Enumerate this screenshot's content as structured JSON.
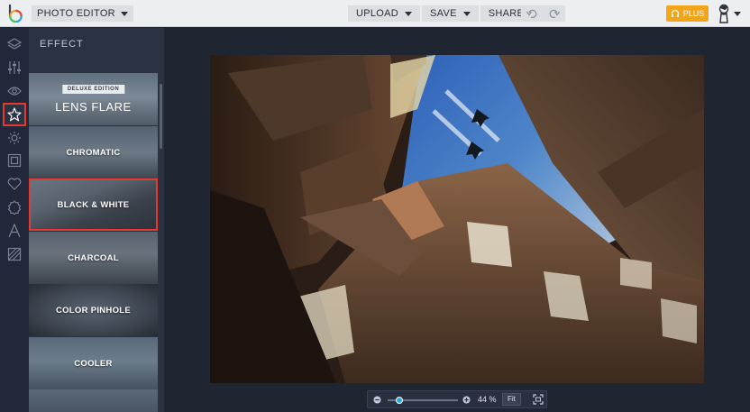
{
  "app": {
    "mode_label": "PHOTO EDITOR"
  },
  "toolbar": {
    "upload_label": "UPLOAD",
    "save_label": "SAVE",
    "share_label": "SHARE",
    "plus_label": "PLUS"
  },
  "rail": {
    "icons": [
      "layers-icon",
      "sliders-icon",
      "eye-icon",
      "star-icon",
      "gear-icon",
      "frame-icon",
      "heart-icon",
      "badge-icon",
      "text-icon",
      "texture-icon"
    ],
    "active": "star-icon"
  },
  "panel": {
    "title": "EFFECT",
    "effects": [
      {
        "badge": "DELUXE EDITION",
        "label": "LENS FLARE"
      },
      {
        "label": "CHROMATIC"
      },
      {
        "label": "BLACK & WHITE",
        "selected": true
      },
      {
        "label": "CHARCOAL"
      },
      {
        "label": "COLOR PINHOLE"
      },
      {
        "label": "COOLER"
      }
    ]
  },
  "zoom": {
    "value": "44",
    "unit": "%",
    "fit_label": "Fit",
    "level": 0.12
  },
  "colors": {
    "accent_red": "#e53a2f",
    "plus_orange": "#f0a51a"
  }
}
